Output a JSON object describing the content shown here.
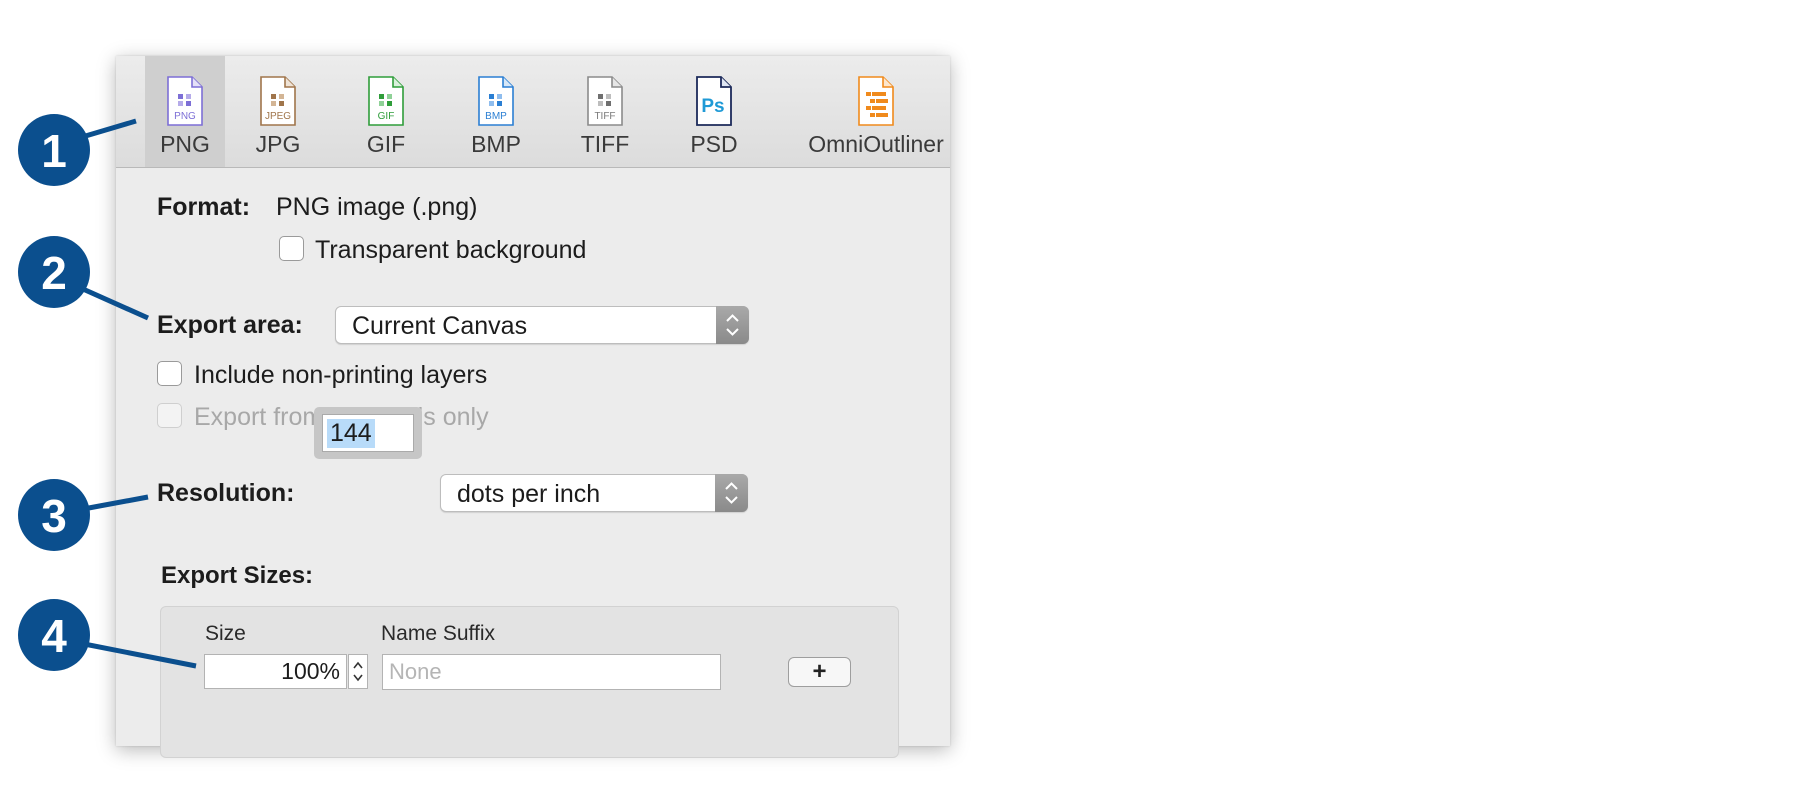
{
  "toolbar": {
    "items": [
      {
        "label": "PNG",
        "icon": "png-file-icon",
        "color": "#7d6fd6",
        "tag": "PNG"
      },
      {
        "label": "JPG",
        "icon": "jpg-file-icon",
        "color": "#a0754b",
        "tag": "JPEG"
      },
      {
        "label": "GIF",
        "icon": "gif-file-icon",
        "color": "#2f9d3a",
        "tag": "GIF"
      },
      {
        "label": "BMP",
        "icon": "bmp-file-icon",
        "color": "#2b7fd3",
        "tag": "BMP"
      },
      {
        "label": "TIFF",
        "icon": "tiff-file-icon",
        "color": "#8b8b8b",
        "tag": "TIFF"
      },
      {
        "label": "PSD",
        "icon": "psd-file-icon",
        "color": "#1f9ad6",
        "tag": "Ps"
      },
      {
        "label": "OmniOutliner",
        "icon": "omnioutliner-file-icon",
        "color": "#f08a1c",
        "tag": ""
      }
    ],
    "selected": "PNG"
  },
  "format": {
    "label": "Format:",
    "value": "PNG image (.png)",
    "transparent_label": "Transparent background",
    "transparent_checked": false
  },
  "export_area": {
    "label": "Export area:",
    "value": "Current Canvas",
    "include_nonprinting_label": "Include non-printing layers",
    "artboards_only_label": "Export from artboards only"
  },
  "resolution": {
    "label": "Resolution:",
    "value": "144",
    "unit": "dots per inch"
  },
  "export_sizes": {
    "title": "Export Sizes:",
    "size_header": "Size",
    "suffix_header": "Name Suffix",
    "size_value": "100%",
    "suffix_placeholder": "None",
    "add_label": "+"
  },
  "callouts": {
    "color": "#0b4f8e",
    "items": [
      "1",
      "2",
      "3",
      "4"
    ]
  }
}
